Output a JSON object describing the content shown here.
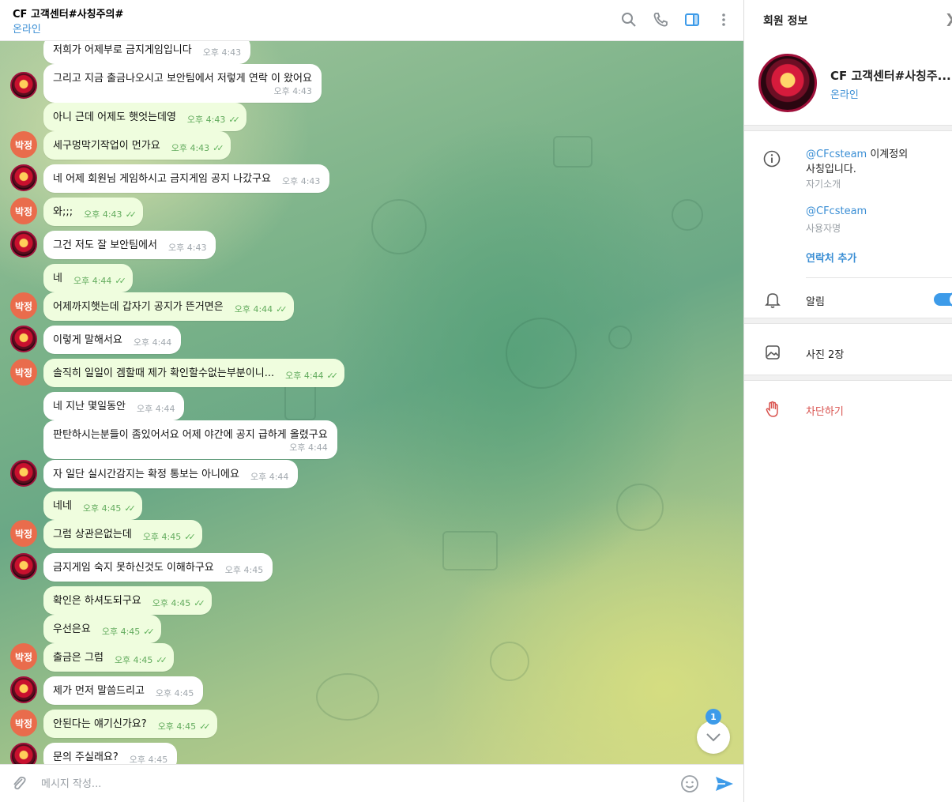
{
  "header": {
    "title": "CF 고객센터#사칭주의#",
    "status": "온라인",
    "icons": [
      "search-icon",
      "phone-icon",
      "sidebar-toggle-icon",
      "more-vertical-icon"
    ]
  },
  "messages": [
    {
      "from": "them",
      "text": "저희가 어제부로 금지게임입니다",
      "time": "오후 4:43"
    },
    {
      "from": "them",
      "text": "그리고 지금 출금나오시고 보안팀에서 저렇게 연락 이 왔어요",
      "time": "오후 4:43"
    },
    {
      "from": "me",
      "text": "아니 근데 어제도 햇엇는데영",
      "time": "오후 4:43"
    },
    {
      "from": "me",
      "text": "세구멍막기작업이 먼가요",
      "time": "오후 4:43"
    },
    {
      "from": "them",
      "text": "네 어제 회원님 게임하시고 금지게임 공지 나갔구요",
      "time": "오후 4:43"
    },
    {
      "from": "me",
      "text": "와;;;",
      "time": "오후 4:43"
    },
    {
      "from": "them",
      "text": "그건 저도 잘 보안팀에서",
      "time": "오후 4:43"
    },
    {
      "from": "me",
      "text": "네",
      "time": "오후 4:44"
    },
    {
      "from": "me",
      "text": "어제까지햇는데 갑자기 공지가 뜬거면은",
      "time": "오후 4:44"
    },
    {
      "from": "them",
      "text": "이렇게 말해서요",
      "time": "오후 4:44"
    },
    {
      "from": "me",
      "text": "솔직히 일일이 겜할때 제가 확인할수없는부분이니...",
      "time": "오후 4:44"
    },
    {
      "from": "them",
      "text": "네 지난 몇일동안",
      "time": "오후 4:44"
    },
    {
      "from": "them",
      "text": "판탄하시는분들이 좀있어서요 어제 야간에 공지 급하게 올렸구요",
      "time": "오후 4:44"
    },
    {
      "from": "them",
      "text": "자 일단 실시간감지는 확정 통보는 아니에요",
      "time": "오후 4:44"
    },
    {
      "from": "me",
      "text": "네네",
      "time": "오후 4:45"
    },
    {
      "from": "me",
      "text": "그럼 상관은없는데",
      "time": "오후 4:45"
    },
    {
      "from": "them",
      "text": "금지게임 숙지 못하신것도 이해하구요",
      "time": "오후 4:45"
    },
    {
      "from": "me",
      "text": "확인은 하셔도되구요",
      "time": "오후 4:45"
    },
    {
      "from": "me",
      "text": "우선은요",
      "time": "오후 4:45"
    },
    {
      "from": "me",
      "text": "출금은 그럼",
      "time": "오후 4:45"
    },
    {
      "from": "them",
      "text": "제가 먼저 말씀드리고",
      "time": "오후 4:45"
    },
    {
      "from": "me",
      "text": "안된다는 얘기신가요?",
      "time": "오후 4:45"
    },
    {
      "from": "them",
      "text": "문의 주실래요?",
      "time": "오후 4:45"
    }
  ],
  "user_avatar_label": "박정",
  "unread_count": "1",
  "composer": {
    "placeholder": "메시지 작성..."
  },
  "panel": {
    "title": "회원 정보",
    "name": "CF 고객센터#사칭주...",
    "status": "온라인",
    "bio_handle": "@CFcsteam",
    "bio_suffix": " 이계정외",
    "bio_line2": "사칭입니다.",
    "bio_label": "자기소개",
    "username": "@CFcsteam",
    "username_label": "사용자명",
    "add_contact": "연락처 추가",
    "notifications_label": "알림",
    "notifications_on": true,
    "photos_label": "사진 2장",
    "block_label": "차단하기"
  },
  "colors": {
    "accent": "#3d9be9",
    "outgoing_bubble": "#effdde",
    "user_avatar": "#e96c4c",
    "danger": "#d9534f"
  }
}
